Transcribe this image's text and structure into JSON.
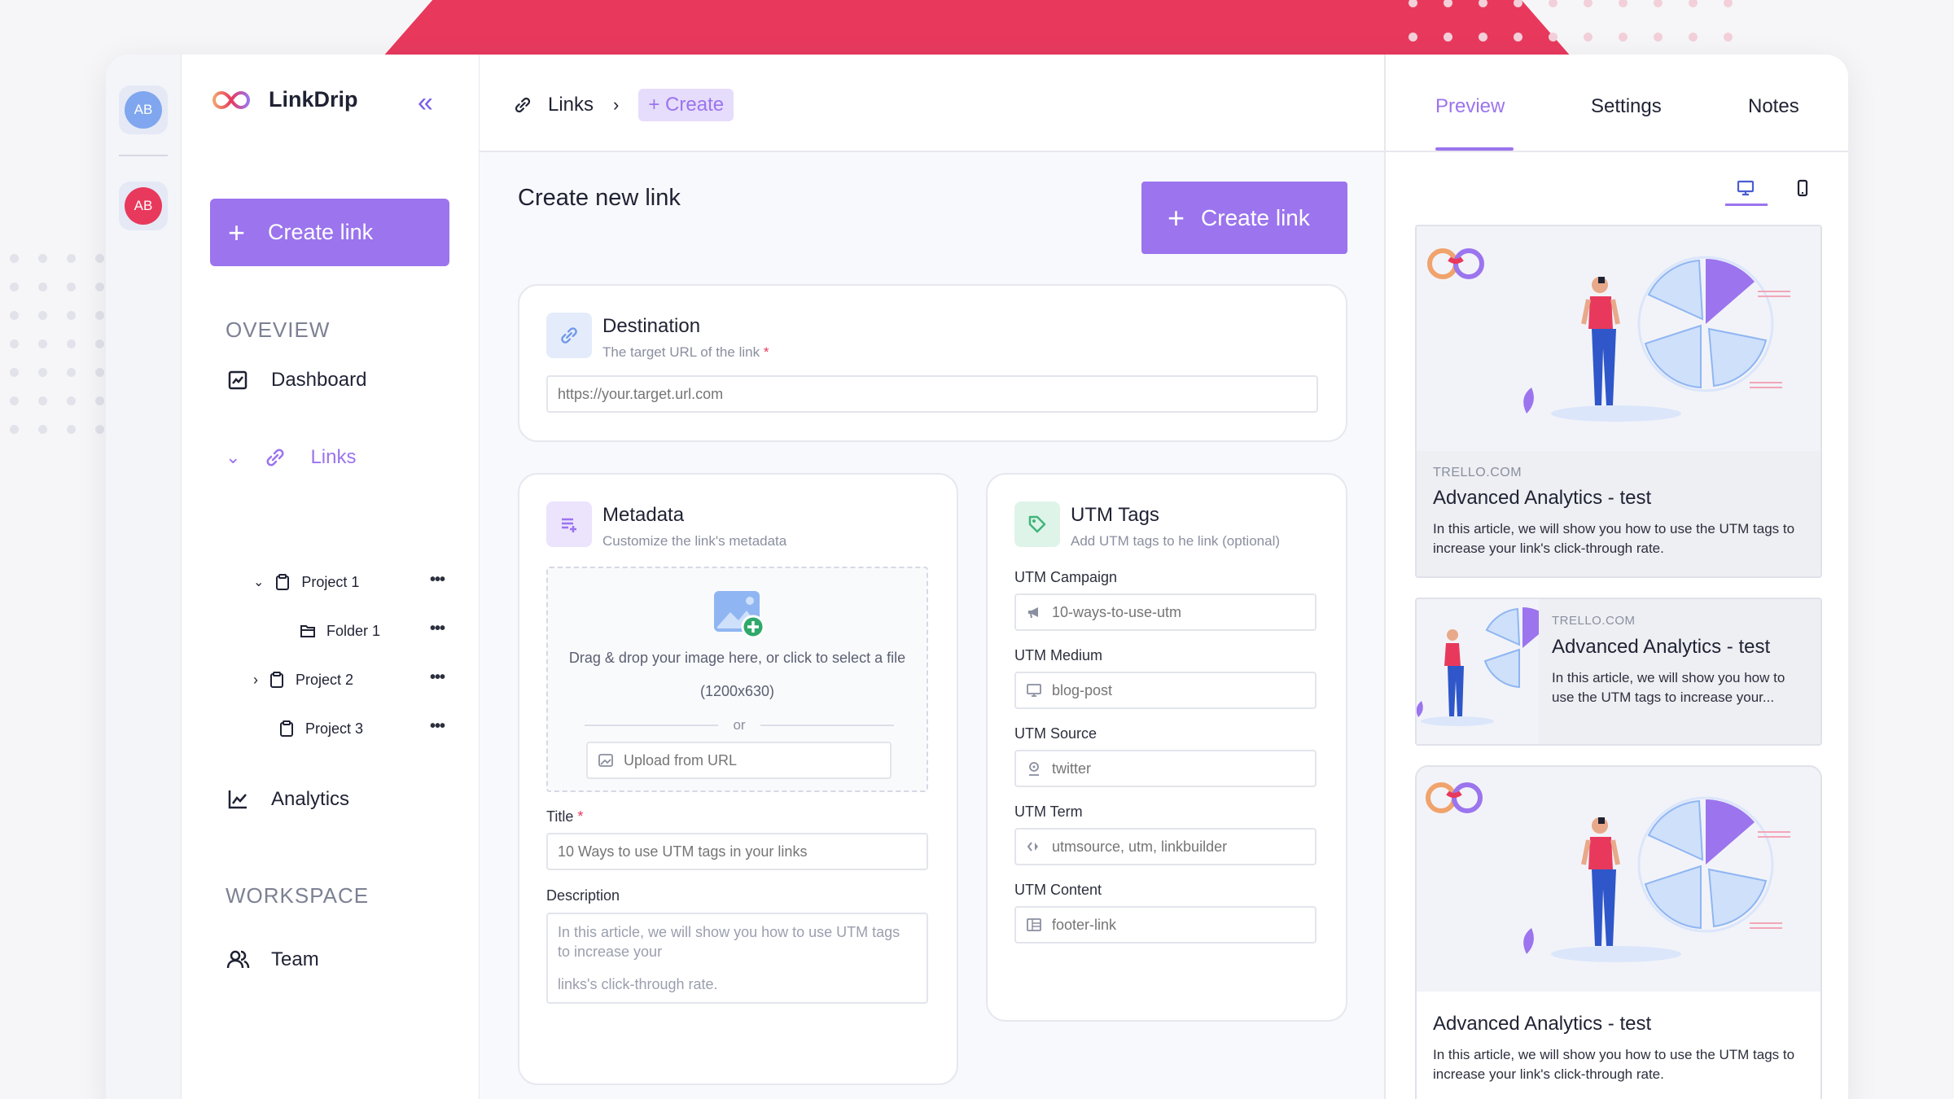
{
  "app": {
    "name": "LinkDrip"
  },
  "rail": {
    "avatars": [
      "AB",
      "AB"
    ]
  },
  "sidebar": {
    "create_label": "Create link",
    "section_overview": "OVEVIEW",
    "dashboard": "Dashboard",
    "links": "Links",
    "tree": {
      "project1": "Project 1",
      "folder1": "Folder 1",
      "project2": "Project 2",
      "project3": "Project 3"
    },
    "analytics": "Analytics",
    "section_workspace": "WORKSPACE",
    "team": "Team"
  },
  "breadcrumb": {
    "links": "Links",
    "create": "Create"
  },
  "main": {
    "title": "Create new link",
    "create_label": "Create link",
    "destination": {
      "title": "Destination",
      "subtitle": "The target URL of the link",
      "required": "*",
      "placeholder": "https://your.target.url.com"
    },
    "metadata": {
      "title": "Metadata",
      "subtitle": "Customize the link's metadata",
      "drop_text": "Drag & drop your image here, or click to select a file",
      "drop_size": "(1200x630)",
      "or": "or",
      "upload_placeholder": "Upload from URL",
      "title_label": "Title",
      "title_required": "*",
      "title_placeholder": "10 Ways to use UTM tags in your links",
      "desc_label": "Description",
      "desc_line1": "In this article, we will show you how to use UTM tags",
      "desc_line2": "to increase your",
      "desc_line3": "links's click-through rate."
    },
    "utm": {
      "title": "UTM Tags",
      "subtitle": "Add UTM tags to he link (optional)",
      "campaign_label": "UTM Campaign",
      "campaign_placeholder": "10-ways-to-use-utm",
      "medium_label": "UTM Medium",
      "medium_placeholder": "blog-post",
      "source_label": "UTM Source",
      "source_placeholder": "twitter",
      "term_label": "UTM Term",
      "term_placeholder": "utmsource, utm, linkbuilder",
      "content_label": "UTM Content",
      "content_placeholder": "footer-link"
    }
  },
  "right": {
    "tabs": [
      "Preview",
      "Settings",
      "Notes"
    ],
    "previews": [
      {
        "domain": "TRELLO.COM",
        "title": "Advanced Analytics - test",
        "desc": "In this article, we will show you how to use the UTM tags to increase your link's click-through rate."
      },
      {
        "domain": "TRELLO.COM",
        "title": "Advanced Analytics - test",
        "desc": "In this article, we will show you how to use the UTM tags to increase your..."
      },
      {
        "title": "Advanced Analytics - test",
        "desc": "In this article, we will show you how to use the UTM tags to increase your link's click-through rate."
      }
    ]
  },
  "colors": {
    "accent": "#9b74ee",
    "brand_red": "#e8395d",
    "avatar_blue": "#7fa6ee",
    "avatar_red": "#e8395d"
  }
}
